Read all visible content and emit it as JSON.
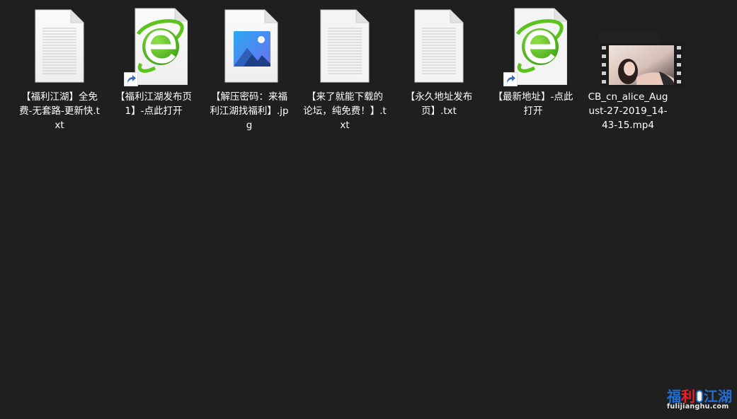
{
  "files": [
    {
      "name": "【福利江湖】全免费-无套路-更新快.txt",
      "type": "text-document",
      "shortcut": false
    },
    {
      "name": "【福利江湖发布页1】-点此打开",
      "type": "browser-shortcut",
      "shortcut": true
    },
    {
      "name": "【解压密码：来福利江湖找福利】.jpg",
      "type": "image-file",
      "shortcut": false
    },
    {
      "name": "【来了就能下载的论坛，纯免费！】.txt",
      "type": "text-document",
      "shortcut": false
    },
    {
      "name": "【永久地址发布页】.txt",
      "type": "text-document",
      "shortcut": false
    },
    {
      "name": "【最新地址】-点此打开",
      "type": "browser-shortcut",
      "shortcut": true
    },
    {
      "name": "CB_cn_alice_August-27-2019_14-43-15.mp4",
      "type": "video-file",
      "shortcut": false
    }
  ],
  "watermark": {
    "chars": [
      "福",
      "利",
      "江",
      "湖"
    ],
    "url": "fulijianghu.com",
    "colors": {
      "blue": "#1f6fd6",
      "red": "#e8212a"
    }
  },
  "colors": {
    "background": "#1f1f1f",
    "ie_green": "#5cc21c",
    "shortcut_arrow": "#2f6fce"
  }
}
